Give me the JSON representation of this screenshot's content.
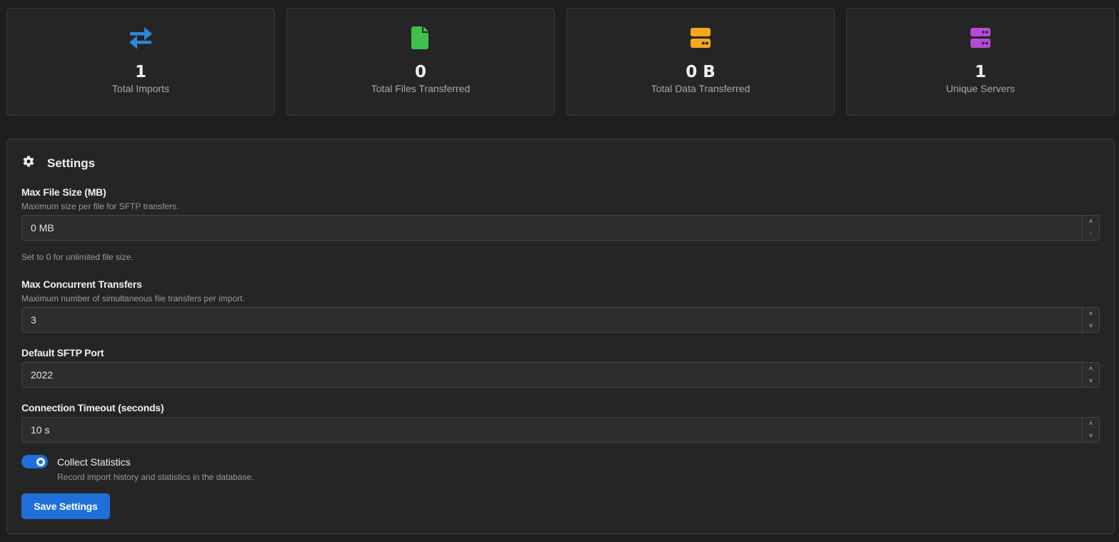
{
  "stats": [
    {
      "icon": "arrows-exchange-icon",
      "value": "1",
      "label": "Total Imports",
      "color": "#2f86de"
    },
    {
      "icon": "file-icon",
      "value": "0",
      "label": "Total Files Transferred",
      "color": "#3cc04d"
    },
    {
      "icon": "hard-drive-icon",
      "value": "0 B",
      "label": "Total Data Transferred",
      "color": "#f6a81a"
    },
    {
      "icon": "server-icon",
      "value": "1",
      "label": "Unique Servers",
      "color": "#b44ad6"
    }
  ],
  "settings": {
    "title": "Settings",
    "icon": "gear-icon",
    "max_file_size": {
      "label": "Max File Size (MB)",
      "help": "Maximum size per file for SFTP transfers.",
      "value": "0 MB",
      "note": "Set to 0 for unlimited file size."
    },
    "max_concurrent": {
      "label": "Max Concurrent Transfers",
      "help": "Maximum number of simultaneous file transfers per import.",
      "value": "3"
    },
    "default_port": {
      "label": "Default SFTP Port",
      "value": "2022"
    },
    "timeout": {
      "label": "Connection Timeout (seconds)",
      "value": "10 s"
    },
    "collect_stats": {
      "label": "Collect Statistics",
      "help": "Record import history and statistics in the database.",
      "enabled": true
    },
    "save_label": "Save Settings"
  },
  "colors": {
    "accent": "#1e6fd9",
    "background": "#1e1e1e",
    "panel": "#252525"
  }
}
